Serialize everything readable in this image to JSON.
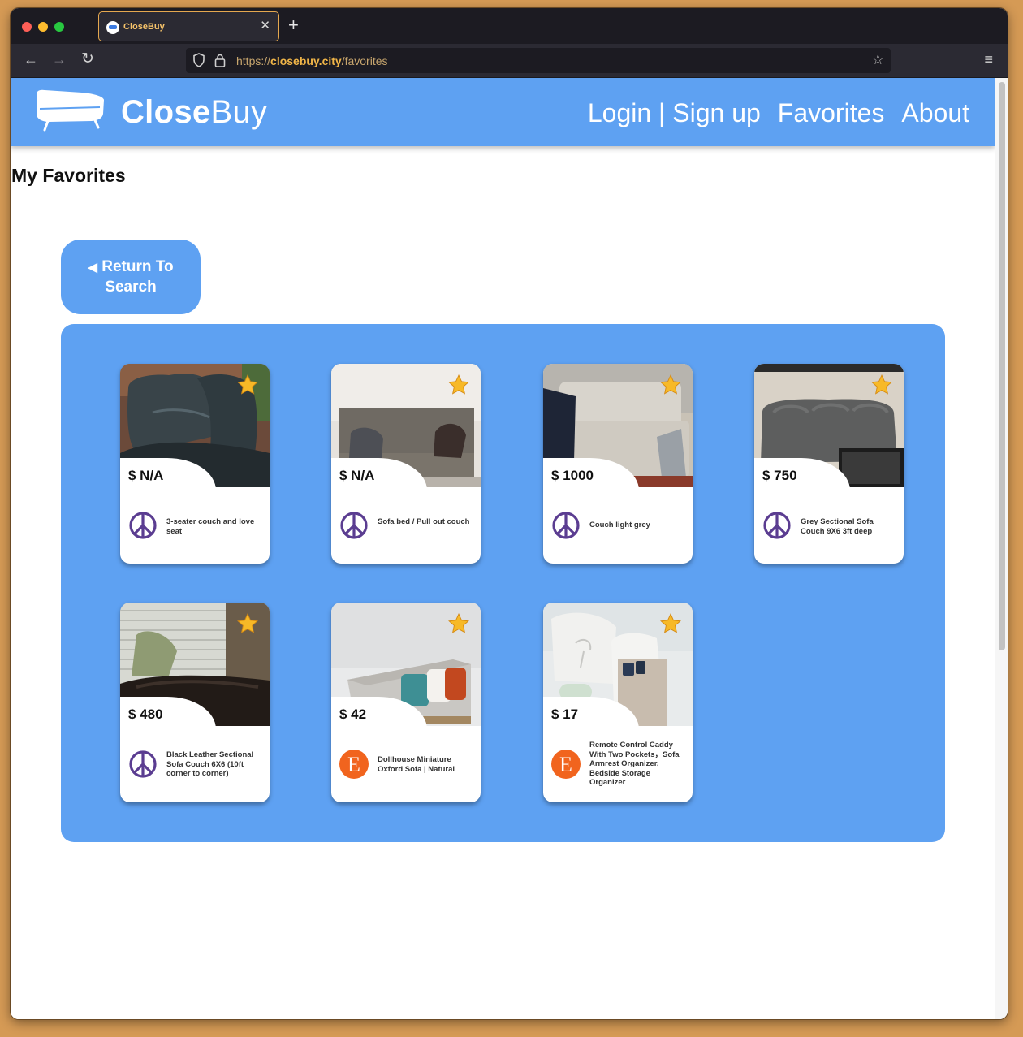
{
  "browser": {
    "tab_title": "CloseBuy",
    "url": {
      "scheme": "https://",
      "host": "closebuy.city",
      "path": "/favorites"
    }
  },
  "header": {
    "brand_bold": "Close",
    "brand_light": "Buy",
    "nav": {
      "login": "Login | Sign up",
      "favorites": "Favorites",
      "about": "About"
    }
  },
  "page": {
    "title": "My Favorites",
    "return_button": {
      "arrow": "◀",
      "line1": "Return To",
      "line2": "Search"
    }
  },
  "favorites": [
    {
      "price": "$ N/A",
      "title": "3-seater couch and love seat",
      "source": "peace-icon"
    },
    {
      "price": "$ N/A",
      "title": "Sofa bed / Pull out couch",
      "source": "peace-icon"
    },
    {
      "price": "$ 1000",
      "title": "Couch light grey",
      "source": "peace-icon"
    },
    {
      "price": "$ 750",
      "title": "Grey Sectional Sofa Couch 9X6 3ft deep",
      "source": "peace-icon"
    },
    {
      "price": "$ 480",
      "title": "Black Leather Sectional Sofa Couch 6X6 (10ft corner to corner)",
      "source": "peace-icon"
    },
    {
      "price": "$ 42",
      "title": "Dollhouse Miniature Oxford Sofa | Natural",
      "source": "etsy-icon"
    },
    {
      "price": "$ 17",
      "title": "Remote Control Caddy With Two Pockets，Sofa Armrest Organizer, Bedside Storage Organizer",
      "source": "etsy-icon"
    }
  ],
  "colors": {
    "brand_blue": "#5ea1f2",
    "star": "#f7b927",
    "peace_purple": "#5b3d91",
    "etsy_orange": "#f1641e"
  }
}
